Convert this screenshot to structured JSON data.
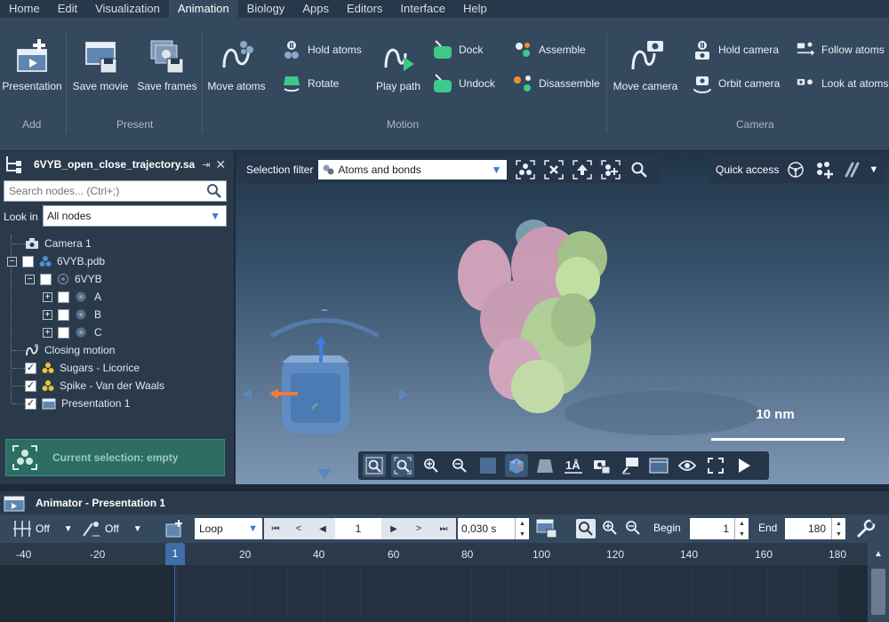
{
  "menu": [
    "Home",
    "Edit",
    "Visualization",
    "Animation",
    "Biology",
    "Apps",
    "Editors",
    "Interface",
    "Help"
  ],
  "menu_active_index": 3,
  "ribbon": {
    "add": {
      "presentation": "Presentation",
      "label": "Add"
    },
    "present": {
      "save_movie": "Save movie",
      "save_frames": "Save frames",
      "label": "Present"
    },
    "motion": {
      "move_atoms": "Move atoms",
      "hold_atoms": "Hold atoms",
      "rotate": "Rotate",
      "play_path": "Play path",
      "dock": "Dock",
      "undock": "Undock",
      "assemble": "Assemble",
      "disassemble": "Disassemble",
      "label": "Motion"
    },
    "camera": {
      "move_camera": "Move camera",
      "hold_camera": "Hold camera",
      "orbit_camera": "Orbit camera",
      "follow_atoms": "Follow atoms",
      "look_at_atoms": "Look at atoms",
      "label": "Camera"
    }
  },
  "document": {
    "title": "6VYB_open_close_trajectory.sa"
  },
  "search": {
    "placeholder": "Search nodes... (Ctrl+;)"
  },
  "look_in": {
    "label": "Look in",
    "value": "All nodes"
  },
  "tree": {
    "camera": "Camera 1",
    "pdb": "6VYB.pdb",
    "mol": "6VYB",
    "chain_a": "A",
    "chain_b": "B",
    "chain_c": "C",
    "motion": "Closing motion",
    "sugars": "Sugars - Licorice",
    "spike": "Spike - Van der Waals",
    "presentation": "Presentation 1"
  },
  "current_selection": "Current selection: empty",
  "viewport": {
    "selection_filter_label": "Selection filter",
    "selection_filter_value": "Atoms and bonds",
    "quick_access": "Quick access",
    "scale_label": "10 nm"
  },
  "animator": {
    "title": "Animator - Presentation 1",
    "toggle1": "Off",
    "toggle2": "Off",
    "mode": "Loop",
    "frame": "1",
    "step": "0,030 s",
    "begin_label": "Begin",
    "begin": "1",
    "end_label": "End",
    "end": "180",
    "ruler_ticks": [
      "-40",
      "-20",
      "1",
      "20",
      "40",
      "60",
      "80",
      "100",
      "120",
      "140",
      "160",
      "180"
    ]
  }
}
